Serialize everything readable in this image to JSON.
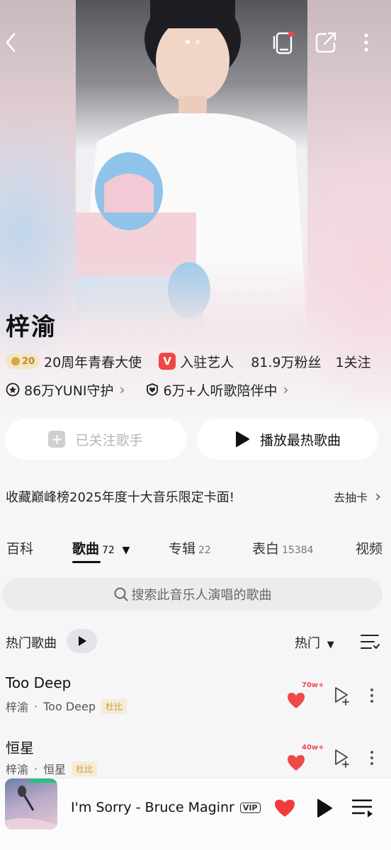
{
  "artist": {
    "name": "梓渝",
    "anniversary_badge": "20",
    "anniversary_label": "20周年青春大使",
    "verified_badge": "V",
    "verified_label": "入驻艺人",
    "fans": "81.9万粉丝",
    "following": "1关注",
    "guard": "86万YUNI守护",
    "listeners": "6万+人听歌陪伴中"
  },
  "buttons": {
    "follow_label": "已关注歌手",
    "play_hot_label": "播放最热歌曲"
  },
  "promo": {
    "text": "收藏巅峰榜2025年度十大音乐限定卡面!",
    "cta": "去抽卡"
  },
  "tabs": [
    {
      "label": "百科",
      "count": ""
    },
    {
      "label": "歌曲",
      "count": "72"
    },
    {
      "label": "专辑",
      "count": "22"
    },
    {
      "label": "表白",
      "count": "15384"
    },
    {
      "label": "视频",
      "count": ""
    }
  ],
  "search": {
    "placeholder": "搜索此音乐人演唱的歌曲"
  },
  "list": {
    "title": "热门歌曲",
    "sort": "热门"
  },
  "songs": [
    {
      "title": "Too Deep",
      "artist": "梓渝",
      "album": "Too Deep",
      "tag": "杜比",
      "likes": "70w+"
    },
    {
      "title": "恒星",
      "artist": "梓渝",
      "album": "恒星",
      "tag": "杜比",
      "likes": "40w+"
    }
  ],
  "now_playing": {
    "title": "I'm Sorry - Bruce Maginr",
    "badge": "VIP"
  },
  "colors": {
    "accent_red": "#f04646",
    "gold": "#c79a3a"
  },
  "icons": [
    "back-icon",
    "device-icon",
    "share-icon",
    "more-icon",
    "heart-icon",
    "add-to-playlist-icon",
    "play-icon",
    "playlist-icon",
    "search-icon",
    "sort-icon"
  ]
}
